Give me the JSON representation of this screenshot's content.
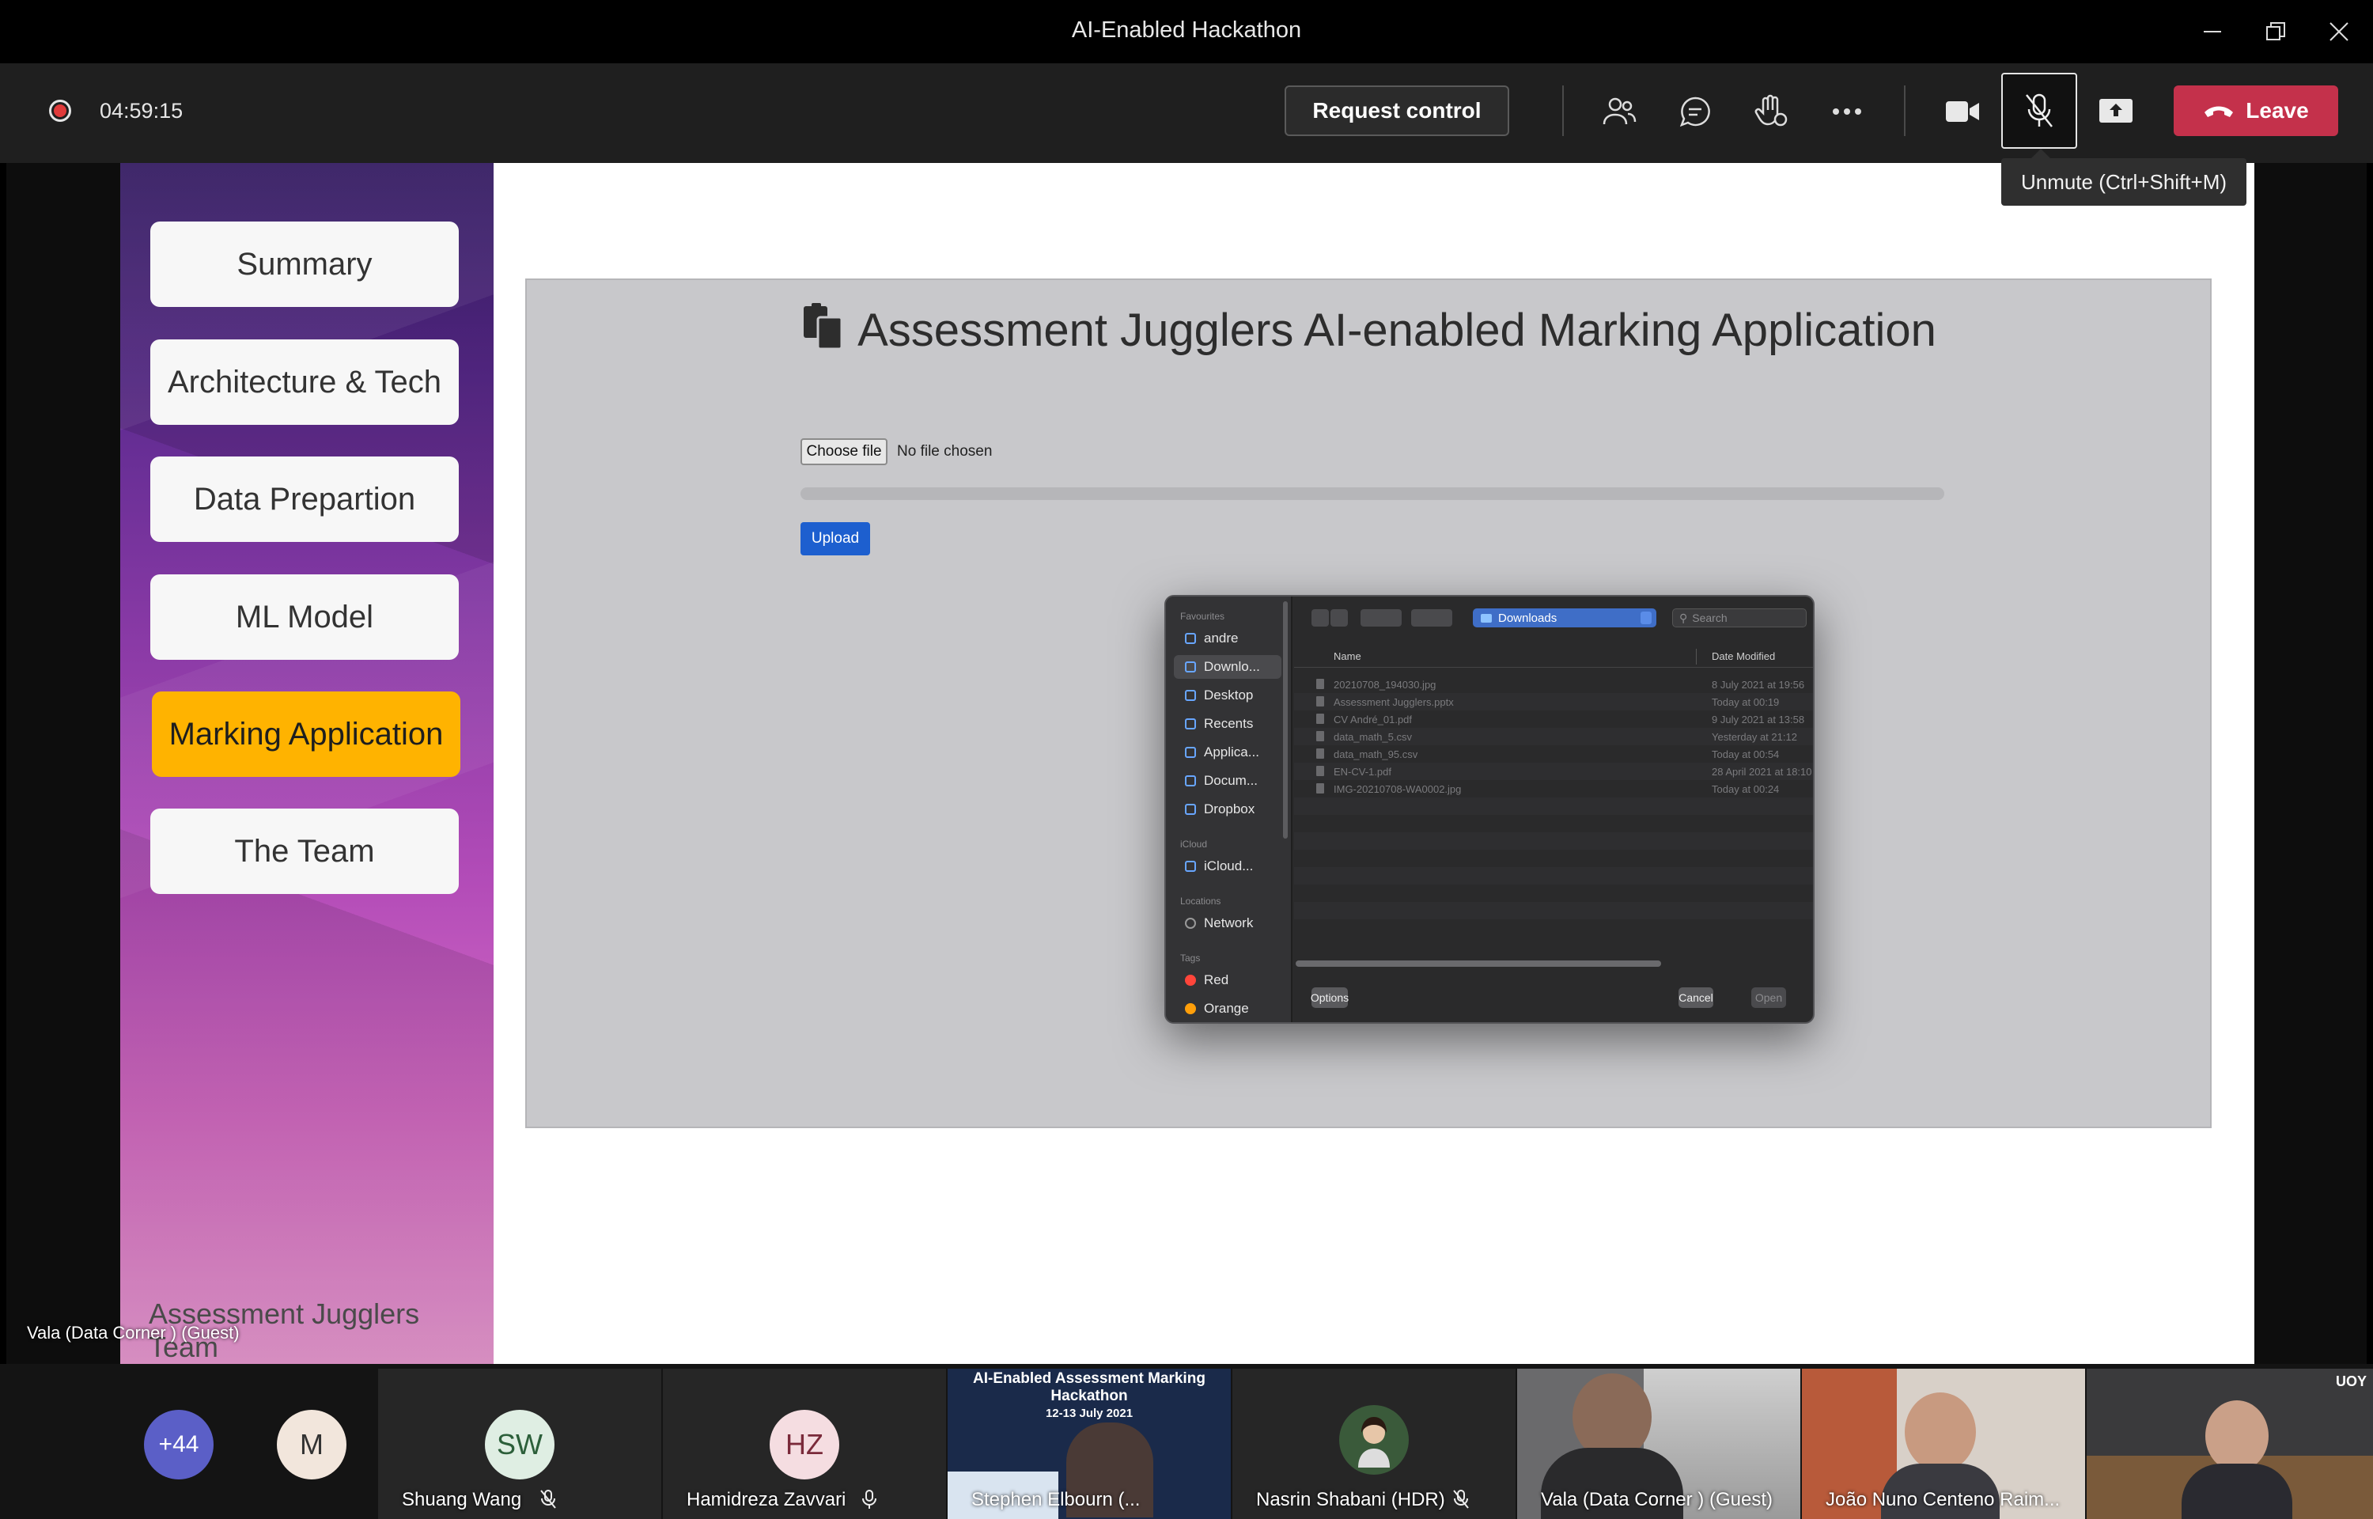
{
  "window": {
    "title": "AI-Enabled Hackathon"
  },
  "toolbar": {
    "timer": "04:59:15",
    "request_control": "Request control",
    "leave": "Leave",
    "mic_tooltip": "Unmute (Ctrl+Shift+M)",
    "icons": [
      "people-icon",
      "chat-icon",
      "raise-hand-icon",
      "more-icon",
      "camera-icon",
      "mic-off-icon",
      "share-icon"
    ]
  },
  "slide": {
    "nav": [
      {
        "label": "Summary"
      },
      {
        "label": "Architecture & Tech"
      },
      {
        "label": "Data Prepartion"
      },
      {
        "label": "ML Model"
      },
      {
        "label": "Marking Application",
        "active": true
      },
      {
        "label": "The Team"
      }
    ],
    "footer": "Assessment Jugglers Team"
  },
  "app": {
    "title": "Assessment Jugglers AI-enabled Marking Application",
    "choose_file": "Choose file",
    "no_file": "No file chosen",
    "upload": "Upload",
    "progress": 0,
    "colors": {
      "upload": "#1d5fcf",
      "active_nav": "#ffb300"
    }
  },
  "dialog": {
    "sections": {
      "favourites": "Favourites",
      "icloud": "iCloud",
      "locations": "Locations",
      "tags": "Tags"
    },
    "favourites": [
      "andre",
      "Downlo...",
      "Desktop",
      "Recents",
      "Applica...",
      "Docum...",
      "Dropbox"
    ],
    "icloud": [
      "iCloud..."
    ],
    "locations": [
      "Network"
    ],
    "tags": [
      {
        "name": "Red",
        "color": "#ff453a"
      },
      {
        "name": "Orange",
        "color": "#ff9f0a"
      }
    ],
    "folder": "Downloads",
    "search_placeholder": "Search",
    "columns": {
      "name": "Name",
      "date": "Date Modified"
    },
    "files": [
      {
        "name": "20210708_194030.jpg",
        "date": "8 July 2021 at 19:56"
      },
      {
        "name": "Assessment Jugglers.pptx",
        "date": "Today at 00:19"
      },
      {
        "name": "CV André_01.pdf",
        "date": "9 July 2021 at 13:58"
      },
      {
        "name": "data_math_5.csv",
        "date": "Yesterday at 21:12"
      },
      {
        "name": "data_math_95.csv",
        "date": "Today at 00:54"
      },
      {
        "name": "EN-CV-1.pdf",
        "date": "28 April 2021 at 18:10"
      },
      {
        "name": "IMG-20210708-WA0002.jpg",
        "date": "Today at 00:24"
      }
    ],
    "options": "Options",
    "cancel": "Cancel",
    "open": "Open"
  },
  "presenter_label": "Vala (Data Corner ) (Guest)",
  "participants": {
    "more_count": "+44",
    "m_initial": "M",
    "tiles": [
      {
        "initials": "SW",
        "name": "Shuang Wang",
        "color": "#dfeee3",
        "muted": true
      },
      {
        "initials": "HZ",
        "name": "Hamidreza Zavvari",
        "color": "#f5dde1",
        "muted": false
      },
      {
        "name": "Stephen Elbourn (...",
        "poster_title": "AI-Enabled Assessment Marking Hackathon",
        "poster_date": "12-13 July 2021"
      },
      {
        "name": "Nasrin Shabani (HDR)",
        "muted": true
      },
      {
        "name": "Vala (Data Corner ) (Guest)"
      },
      {
        "name": "João Nuno Centeno Raim..."
      },
      {
        "name": "UOY"
      }
    ]
  }
}
